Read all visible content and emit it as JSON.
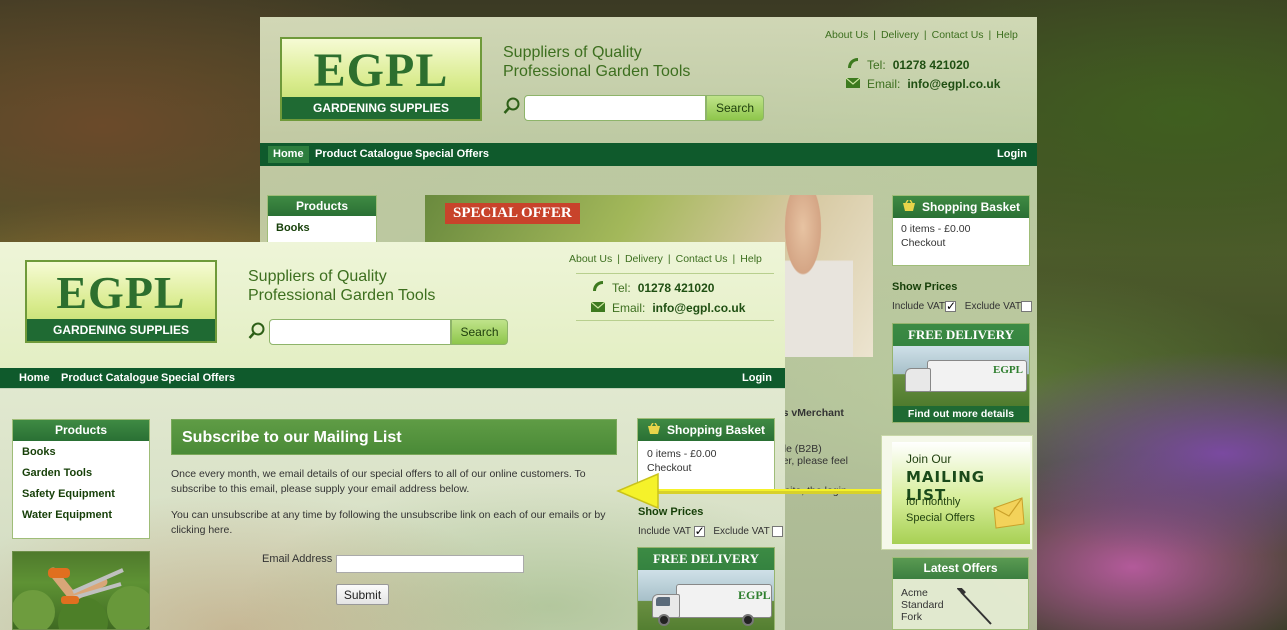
{
  "brand": {
    "logo_text": "EGPL",
    "logo_subtitle": "GARDENING SUPPLIES",
    "tagline_line1": "Suppliers of Quality",
    "tagline_line2": "Professional Garden Tools"
  },
  "top_links": [
    "About Us",
    "Delivery",
    "Contact Us",
    "Help"
  ],
  "contact": {
    "tel_label": "Tel:",
    "tel_number": "01278 421020",
    "email_label": "Email:",
    "email_value": "info@egpl.co.uk"
  },
  "search": {
    "button_label": "Search",
    "placeholder": ""
  },
  "nav": {
    "items": [
      "Home",
      "Product Catalogue",
      "Special Offers"
    ],
    "login": "Login"
  },
  "products_panel": {
    "title": "Products",
    "items": [
      "Books",
      "Garden Tools",
      "Safety Equipment",
      "Water Equipment"
    ]
  },
  "subscribe": {
    "title": "Subscribe to our Mailing List",
    "para1": "Once every month, we email details of our special offers to all of our online customers. To subscribe to this email, please supply your email address below.",
    "para2": "You can unsubscribe at any time by following the unsubscribe link on each of our emails or by clicking here.",
    "email_label": "Email Address",
    "email_value": "",
    "submit_label": "Submit"
  },
  "basket": {
    "title": "Shopping Basket",
    "summary": "0 items - £0.00",
    "checkout": "Checkout"
  },
  "prices": {
    "title": "Show Prices",
    "include_vat": "Include VAT",
    "exclude_vat": "Exclude VAT",
    "include_checked": true,
    "exclude_checked": false
  },
  "delivery_promo": {
    "title": "FREE DELIVERY",
    "van_logo": "EGPL",
    "footer": "Find out more details"
  },
  "background_page": {
    "special_offer_banner": "SPECIAL OFFER",
    "snippet_1": "axis vMerchant",
    "snippet_2": "trade (B2B)",
    "snippet_3": "omer, please feel",
    "snippet_4": "ion site, the login"
  },
  "mailing_list": {
    "line1": "Join Our",
    "line2": "MAILING LIST",
    "line3": "for monthly",
    "line4": "Special Offers"
  },
  "latest_offers": {
    "title": "Latest Offers",
    "item_line1": "Acme",
    "item_line2": "Standard",
    "item_line3": "Fork"
  },
  "colors": {
    "brand_green": "#1f6a33",
    "nav_green": "#0f5a2c",
    "arrow_yellow": "#f5f22a"
  }
}
